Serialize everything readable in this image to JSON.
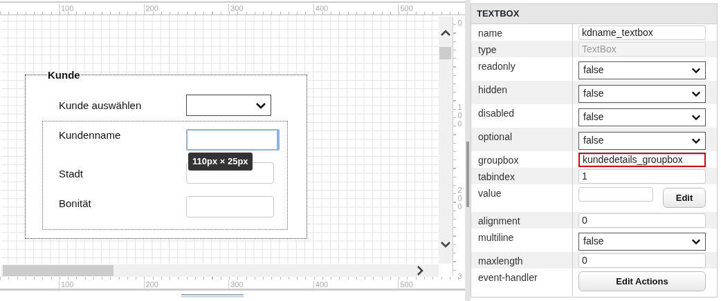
{
  "ruler_top": {
    "labels": [
      "100",
      "200",
      "300",
      "400",
      "500"
    ]
  },
  "ruler_bottom": {
    "labels": [
      "100",
      "200",
      "300",
      "400",
      "500"
    ]
  },
  "ruler_side": {
    "labels": [
      "0",
      "100",
      "200",
      "3"
    ]
  },
  "form": {
    "groupbox": {
      "title": "Kunde"
    },
    "fields": [
      {
        "label": "Kunde auswählen",
        "kind": "dropdown",
        "selected": false
      },
      {
        "label": "Kundenname",
        "kind": "textbox",
        "selected": true
      },
      {
        "label": "Stadt",
        "kind": "textbox",
        "selected": false
      },
      {
        "label": "Bonität",
        "kind": "textbox",
        "selected": false
      }
    ],
    "size_tooltip": "110px × 25px"
  },
  "properties": {
    "title": "TEXTBOX",
    "rows": [
      {
        "name": "name",
        "kind": "text",
        "value": "kdname_textbox",
        "disabled": false,
        "highlighted": false
      },
      {
        "name": "type",
        "kind": "text",
        "value": "TextBox",
        "disabled": true,
        "highlighted": false
      },
      {
        "name": "readonly",
        "kind": "dropdown",
        "value": "false"
      },
      {
        "name": "hidden",
        "kind": "dropdown",
        "value": "false"
      },
      {
        "name": "disabled",
        "kind": "dropdown",
        "value": "false"
      },
      {
        "name": "optional",
        "kind": "dropdown",
        "value": "false"
      },
      {
        "name": "groupbox",
        "kind": "text",
        "value": "kundedetails_groupbox",
        "disabled": false,
        "highlighted": true
      },
      {
        "name": "tabindex",
        "kind": "text",
        "value": "1",
        "disabled": false,
        "highlighted": false
      },
      {
        "name": "value",
        "kind": "text_button",
        "button": "Edit"
      },
      {
        "name": "alignment",
        "kind": "text",
        "value": "0",
        "disabled": false,
        "highlighted": false
      },
      {
        "name": "multiline",
        "kind": "dropdown",
        "value": "false"
      },
      {
        "name": "maxlength",
        "kind": "text",
        "value": "0",
        "disabled": false,
        "highlighted": false
      },
      {
        "name": "event-handler",
        "kind": "button",
        "button": "Edit Actions"
      }
    ]
  }
}
